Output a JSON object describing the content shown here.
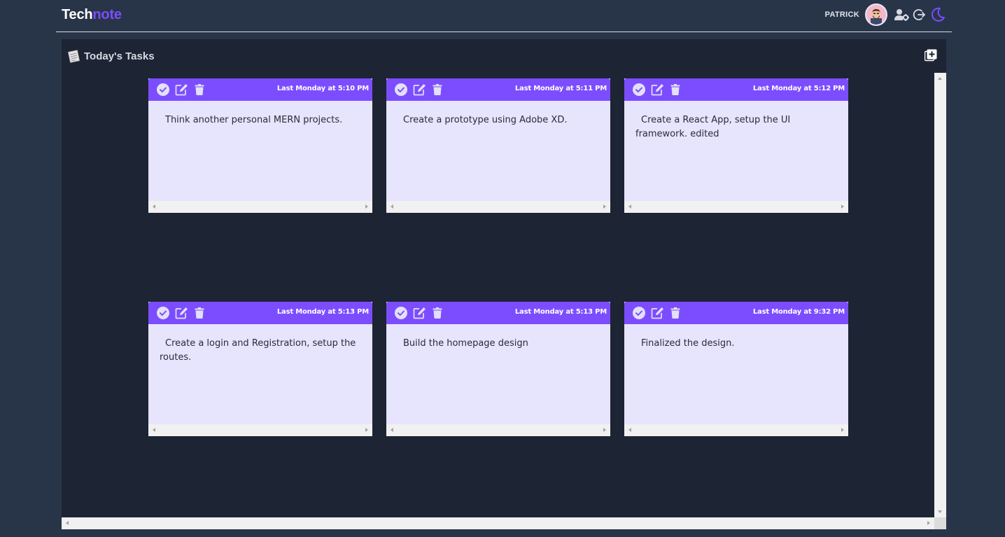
{
  "app": {
    "brand_part1": "Tech",
    "brand_part2": "note",
    "accent": "#7c4dff",
    "background": "#283549"
  },
  "header": {
    "username": "PATRICK",
    "icons": [
      "avatar",
      "user-settings-icon",
      "logout-icon",
      "moon-icon"
    ]
  },
  "panel": {
    "title": "Today's Tasks",
    "title_icon": "notepad-icon",
    "add_icon": "add-square-icon"
  },
  "tasks": [
    {
      "time": "Last Monday at 5:10 PM",
      "text": "Think another personal MERN projects."
    },
    {
      "time": "Last Monday at 5:11 PM",
      "text": "Create a prototype using Adobe XD."
    },
    {
      "time": "Last Monday at 5:12 PM",
      "text": "Create a React App, setup the UI framework. edited"
    },
    {
      "time": "Last Monday at 5:13 PM",
      "text": "Create a login and Registration, setup the routes."
    },
    {
      "time": "Last Monday at 5:13 PM",
      "text": "Build the homepage design"
    },
    {
      "time": "Last Monday at 9:32 PM",
      "text": "Finalized the design."
    }
  ],
  "card_actions": [
    "check-circle-icon",
    "edit-icon",
    "trash-icon"
  ]
}
